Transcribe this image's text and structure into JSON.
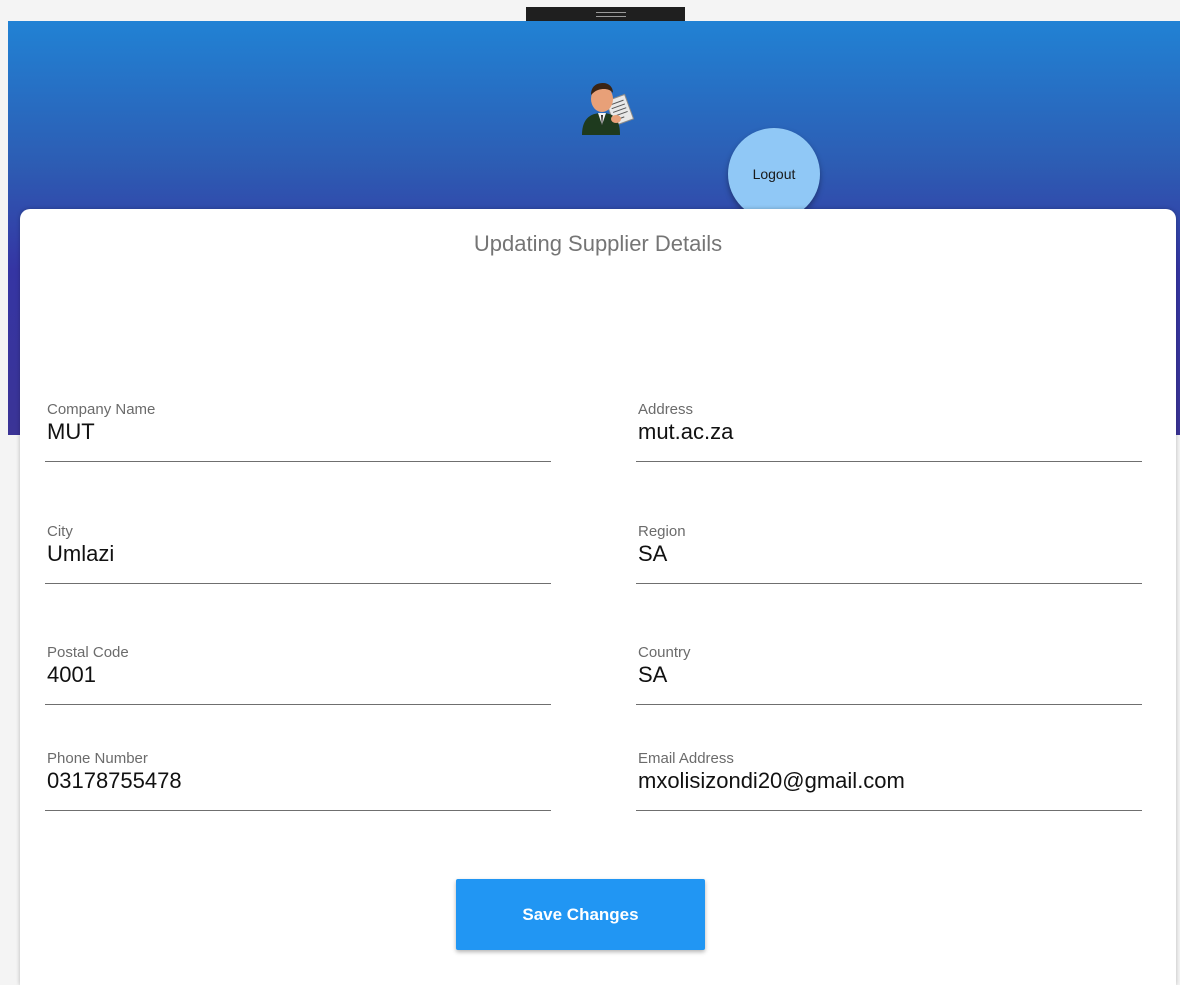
{
  "header": {
    "logout_label": "Logout"
  },
  "form": {
    "title": "Updating Supplier Details",
    "fields": [
      {
        "label": "Company Name",
        "value": "MUT"
      },
      {
        "label": "Address",
        "value": "mut.ac.za"
      },
      {
        "label": "City",
        "value": "Umlazi"
      },
      {
        "label": "Region",
        "value": "SA"
      },
      {
        "label": "Postal Code",
        "value": "4001"
      },
      {
        "label": "Country",
        "value": "SA"
      },
      {
        "label": "Phone Number",
        "value": "03178755478"
      },
      {
        "label": "Email Address",
        "value": "mxolisizondi20@gmail.com"
      }
    ],
    "save_label": "Save Changes"
  },
  "icons": {
    "avatar": "businessman-avatar-icon"
  },
  "colors": {
    "header_top": "#2182d4",
    "header_bottom": "#3b3496",
    "logout_bg": "#90c8f6",
    "save_bg": "#2196f3"
  }
}
